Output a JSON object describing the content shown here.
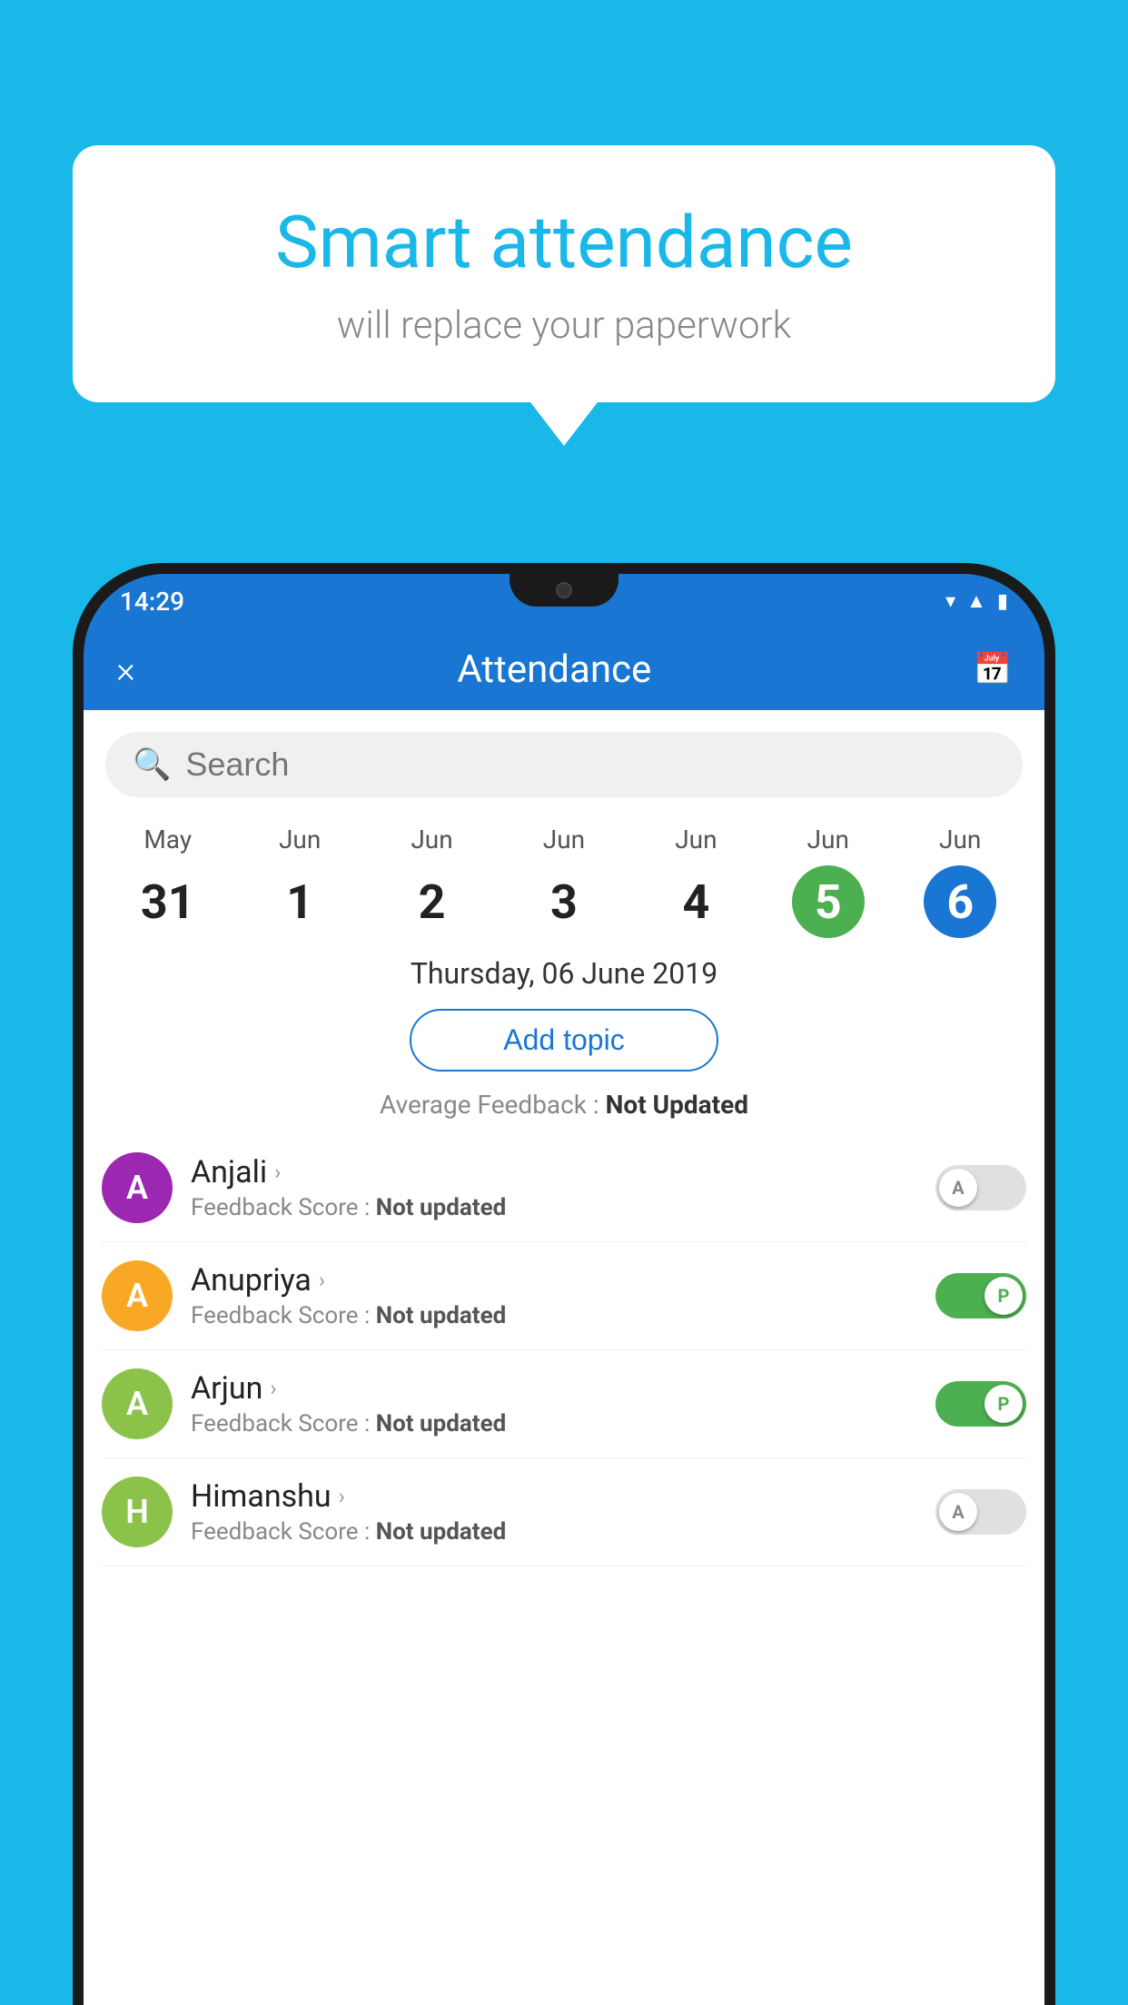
{
  "background_color": "#1ab8e8",
  "bubble": {
    "title": "Smart attendance",
    "subtitle": "will replace your paperwork"
  },
  "status_bar": {
    "time": "14:29",
    "icons": [
      "wifi",
      "signal",
      "battery"
    ]
  },
  "header": {
    "close_label": "×",
    "title": "Attendance",
    "calendar_icon": "📅"
  },
  "search": {
    "placeholder": "Search"
  },
  "dates": [
    {
      "month": "May",
      "day": "31",
      "style": "normal"
    },
    {
      "month": "Jun",
      "day": "1",
      "style": "normal"
    },
    {
      "month": "Jun",
      "day": "2",
      "style": "normal"
    },
    {
      "month": "Jun",
      "day": "3",
      "style": "normal"
    },
    {
      "month": "Jun",
      "day": "4",
      "style": "normal"
    },
    {
      "month": "Jun",
      "day": "5",
      "style": "green"
    },
    {
      "month": "Jun",
      "day": "6",
      "style": "blue"
    }
  ],
  "selected_date": "Thursday, 06 June 2019",
  "add_topic_label": "Add topic",
  "avg_feedback_label": "Average Feedback : ",
  "avg_feedback_value": "Not Updated",
  "students": [
    {
      "name": "Anjali",
      "initial": "A",
      "avatar_color": "#9c27b0",
      "feedback_label": "Feedback Score : ",
      "feedback_value": "Not updated",
      "toggle": "off",
      "toggle_letter": "A"
    },
    {
      "name": "Anupriya",
      "initial": "A",
      "avatar_color": "#f9a825",
      "feedback_label": "Feedback Score : ",
      "feedback_value": "Not updated",
      "toggle": "on",
      "toggle_letter": "P"
    },
    {
      "name": "Arjun",
      "initial": "A",
      "avatar_color": "#8bc34a",
      "feedback_label": "Feedback Score : ",
      "feedback_value": "Not updated",
      "toggle": "on",
      "toggle_letter": "P"
    },
    {
      "name": "Himanshu",
      "initial": "H",
      "avatar_color": "#8bc34a",
      "feedback_label": "Feedback Score : ",
      "feedback_value": "Not updated",
      "toggle": "off",
      "toggle_letter": "A"
    }
  ]
}
